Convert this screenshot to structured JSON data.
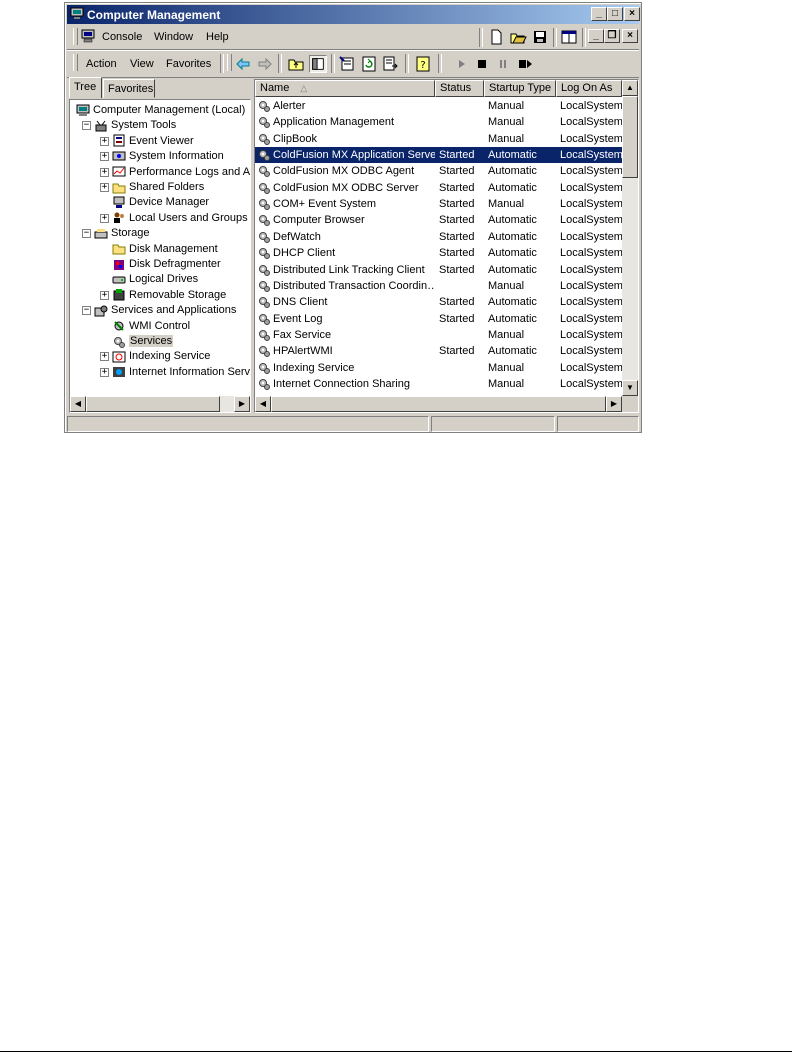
{
  "window": {
    "title": "Computer Management"
  },
  "menubar": {
    "items": [
      {
        "label": "Console"
      },
      {
        "label": "Window"
      },
      {
        "label": "Help"
      }
    ]
  },
  "actionbar": {
    "items": [
      {
        "label": "Action"
      },
      {
        "label": "View"
      },
      {
        "label": "Favorites"
      }
    ]
  },
  "tabs": [
    {
      "label": "Tree"
    },
    {
      "label": "Favorites"
    }
  ],
  "tree": [
    {
      "label": "Computer Management (Local)"
    },
    {
      "label": "System Tools"
    },
    {
      "label": "Event Viewer"
    },
    {
      "label": "System Information"
    },
    {
      "label": "Performance Logs and Aler"
    },
    {
      "label": "Shared Folders"
    },
    {
      "label": "Device Manager"
    },
    {
      "label": "Local Users and Groups"
    },
    {
      "label": "Storage"
    },
    {
      "label": "Disk Management"
    },
    {
      "label": "Disk Defragmenter"
    },
    {
      "label": "Logical Drives"
    },
    {
      "label": "Removable Storage"
    },
    {
      "label": "Services and Applications"
    },
    {
      "label": "WMI Control"
    },
    {
      "label": "Services"
    },
    {
      "label": "Indexing Service"
    },
    {
      "label": "Internet Information Servi"
    }
  ],
  "columns": {
    "name": "Name",
    "sort_arrow": "△",
    "status": "Status",
    "startup": "Startup Type",
    "logon": "Log On As"
  },
  "services": [
    {
      "name": "Alerter",
      "status": "",
      "startup": "Manual",
      "logon": "LocalSystem"
    },
    {
      "name": "Application Management",
      "status": "",
      "startup": "Manual",
      "logon": "LocalSystem"
    },
    {
      "name": "ClipBook",
      "status": "",
      "startup": "Manual",
      "logon": "LocalSystem"
    },
    {
      "name": "ColdFusion MX Application Server",
      "status": "Started",
      "startup": "Automatic",
      "logon": "LocalSystem"
    },
    {
      "name": "ColdFusion MX ODBC Agent",
      "status": "Started",
      "startup": "Automatic",
      "logon": "LocalSystem"
    },
    {
      "name": "ColdFusion MX ODBC Server",
      "status": "Started",
      "startup": "Automatic",
      "logon": "LocalSystem"
    },
    {
      "name": "COM+ Event System",
      "status": "Started",
      "startup": "Manual",
      "logon": "LocalSystem"
    },
    {
      "name": "Computer Browser",
      "status": "Started",
      "startup": "Automatic",
      "logon": "LocalSystem"
    },
    {
      "name": "DefWatch",
      "status": "Started",
      "startup": "Automatic",
      "logon": "LocalSystem"
    },
    {
      "name": "DHCP Client",
      "status": "Started",
      "startup": "Automatic",
      "logon": "LocalSystem"
    },
    {
      "name": "Distributed Link Tracking Client",
      "status": "Started",
      "startup": "Automatic",
      "logon": "LocalSystem"
    },
    {
      "name": "Distributed Transaction Coordin…",
      "status": "",
      "startup": "Manual",
      "logon": "LocalSystem"
    },
    {
      "name": "DNS Client",
      "status": "Started",
      "startup": "Automatic",
      "logon": "LocalSystem"
    },
    {
      "name": "Event Log",
      "status": "Started",
      "startup": "Automatic",
      "logon": "LocalSystem"
    },
    {
      "name": "Fax Service",
      "status": "",
      "startup": "Manual",
      "logon": "LocalSystem"
    },
    {
      "name": "HPAlertWMI",
      "status": "Started",
      "startup": "Automatic",
      "logon": "LocalSystem"
    },
    {
      "name": "Indexing Service",
      "status": "",
      "startup": "Manual",
      "logon": "LocalSystem"
    },
    {
      "name": "Internet Connection Sharing",
      "status": "",
      "startup": "Manual",
      "logon": "LocalSystem"
    }
  ],
  "selected_service": "ColdFusion MX Application Server",
  "colors": {
    "selection": "#0a246a",
    "face": "#d4d0c8"
  }
}
